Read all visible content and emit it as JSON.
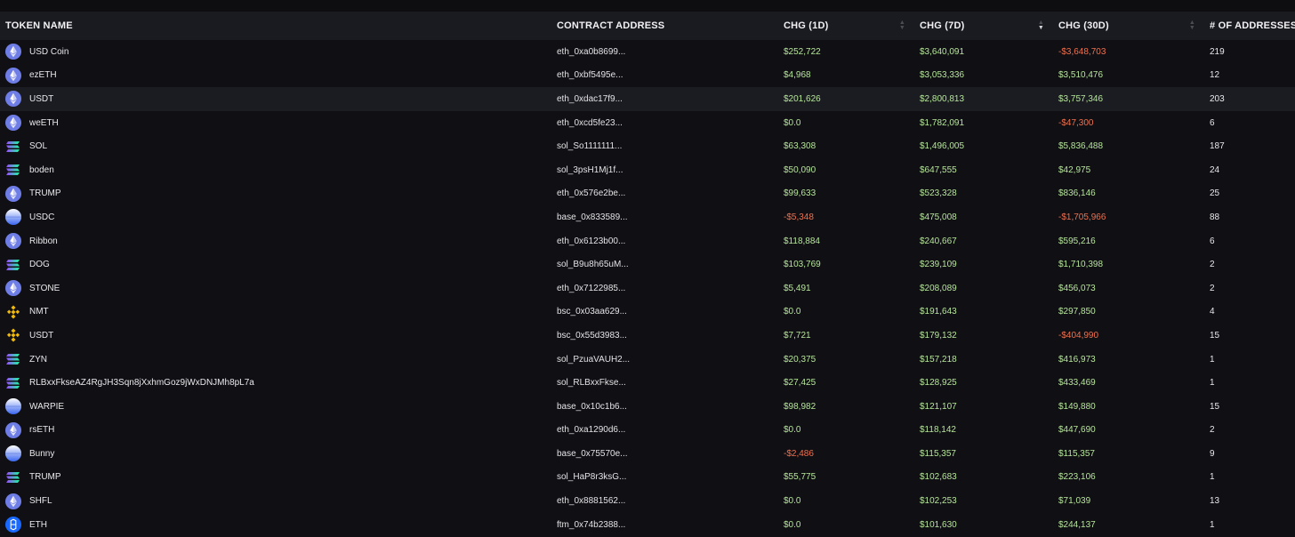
{
  "columns": {
    "token_name": "TOKEN NAME",
    "contract_address": "CONTRACT ADDRESS",
    "chg_1d": "CHG (1D)",
    "chg_7d": "CHG (7D)",
    "chg_30d": "CHG (30D)",
    "num_addresses": "# OF ADDRESSES"
  },
  "sort": {
    "column": "chg_7d",
    "direction": "descending"
  },
  "colors": {
    "positive": "#b6e59a",
    "negative": "#f0704e",
    "header_bg": "#1a1b20",
    "page_bg": "#101014"
  },
  "rows": [
    {
      "name": "USD Coin",
      "chain_icon": "ethereum-icon",
      "address": "eth_0xa0b8699...",
      "chg_1d": "$252,722",
      "chg_7d": "$3,640,091",
      "chg_30d": "-$3,648,703",
      "addresses": "219"
    },
    {
      "name": "ezETH",
      "chain_icon": "ethereum-icon",
      "address": "eth_0xbf5495e...",
      "chg_1d": "$4,968",
      "chg_7d": "$3,053,336",
      "chg_30d": "$3,510,476",
      "addresses": "12"
    },
    {
      "name": "USDT",
      "chain_icon": "ethereum-icon",
      "address": "eth_0xdac17f9...",
      "chg_1d": "$201,626",
      "chg_7d": "$2,800,813",
      "chg_30d": "$3,757,346",
      "addresses": "203"
    },
    {
      "name": "weETH",
      "chain_icon": "ethereum-icon",
      "address": "eth_0xcd5fe23...",
      "chg_1d": "$0.0",
      "chg_7d": "$1,782,091",
      "chg_30d": "-$47,300",
      "addresses": "6"
    },
    {
      "name": "SOL",
      "chain_icon": "solana-icon",
      "address": "sol_So1111111...",
      "chg_1d": "$63,308",
      "chg_7d": "$1,496,005",
      "chg_30d": "$5,836,488",
      "addresses": "187"
    },
    {
      "name": "boden",
      "chain_icon": "solana-icon",
      "address": "sol_3psH1Mj1f...",
      "chg_1d": "$50,090",
      "chg_7d": "$647,555",
      "chg_30d": "$42,975",
      "addresses": "24"
    },
    {
      "name": "TRUMP",
      "chain_icon": "ethereum-icon",
      "address": "eth_0x576e2be...",
      "chg_1d": "$99,633",
      "chg_7d": "$523,328",
      "chg_30d": "$836,146",
      "addresses": "25"
    },
    {
      "name": "USDC",
      "chain_icon": "base-icon",
      "address": "base_0x833589...",
      "chg_1d": "-$5,348",
      "chg_7d": "$475,008",
      "chg_30d": "-$1,705,966",
      "addresses": "88"
    },
    {
      "name": "Ribbon",
      "chain_icon": "ethereum-icon",
      "address": "eth_0x6123b00...",
      "chg_1d": "$118,884",
      "chg_7d": "$240,667",
      "chg_30d": "$595,216",
      "addresses": "6"
    },
    {
      "name": "DOG",
      "chain_icon": "solana-icon",
      "address": "sol_B9u8h65uM...",
      "chg_1d": "$103,769",
      "chg_7d": "$239,109",
      "chg_30d": "$1,710,398",
      "addresses": "2"
    },
    {
      "name": "STONE",
      "chain_icon": "ethereum-icon",
      "address": "eth_0x7122985...",
      "chg_1d": "$5,491",
      "chg_7d": "$208,089",
      "chg_30d": "$456,073",
      "addresses": "2"
    },
    {
      "name": "NMT",
      "chain_icon": "bnb-icon",
      "address": "bsc_0x03aa629...",
      "chg_1d": "$0.0",
      "chg_7d": "$191,643",
      "chg_30d": "$297,850",
      "addresses": "4"
    },
    {
      "name": "USDT",
      "chain_icon": "bnb-icon",
      "address": "bsc_0x55d3983...",
      "chg_1d": "$7,721",
      "chg_7d": "$179,132",
      "chg_30d": "-$404,990",
      "addresses": "15"
    },
    {
      "name": "ZYN",
      "chain_icon": "solana-icon",
      "address": "sol_PzuaVAUH2...",
      "chg_1d": "$20,375",
      "chg_7d": "$157,218",
      "chg_30d": "$416,973",
      "addresses": "1"
    },
    {
      "name": "RLBxxFkseAZ4RgJH3Sqn8jXxhmGoz9jWxDNJMh8pL7a",
      "chain_icon": "solana-icon",
      "address": "sol_RLBxxFkse...",
      "chg_1d": "$27,425",
      "chg_7d": "$128,925",
      "chg_30d": "$433,469",
      "addresses": "1"
    },
    {
      "name": "WARPIE",
      "chain_icon": "base-icon",
      "address": "base_0x10c1b6...",
      "chg_1d": "$98,982",
      "chg_7d": "$121,107",
      "chg_30d": "$149,880",
      "addresses": "15"
    },
    {
      "name": "rsETH",
      "chain_icon": "ethereum-icon",
      "address": "eth_0xa1290d6...",
      "chg_1d": "$0.0",
      "chg_7d": "$118,142",
      "chg_30d": "$447,690",
      "addresses": "2"
    },
    {
      "name": "Bunny",
      "chain_icon": "base-icon",
      "address": "base_0x75570e...",
      "chg_1d": "-$2,486",
      "chg_7d": "$115,357",
      "chg_30d": "$115,357",
      "addresses": "9"
    },
    {
      "name": "TRUMP",
      "chain_icon": "solana-icon",
      "address": "sol_HaP8r3ksG...",
      "chg_1d": "$55,775",
      "chg_7d": "$102,683",
      "chg_30d": "$223,106",
      "addresses": "1"
    },
    {
      "name": "SHFL",
      "chain_icon": "ethereum-icon",
      "address": "eth_0x8881562...",
      "chg_1d": "$0.0",
      "chg_7d": "$102,253",
      "chg_30d": "$71,039",
      "addresses": "13"
    },
    {
      "name": "ETH",
      "chain_icon": "fantom-icon",
      "address": "ftm_0x74b2388...",
      "chg_1d": "$0.0",
      "chg_7d": "$101,630",
      "chg_30d": "$244,137",
      "addresses": "1"
    }
  ],
  "highlighted_row": 2
}
